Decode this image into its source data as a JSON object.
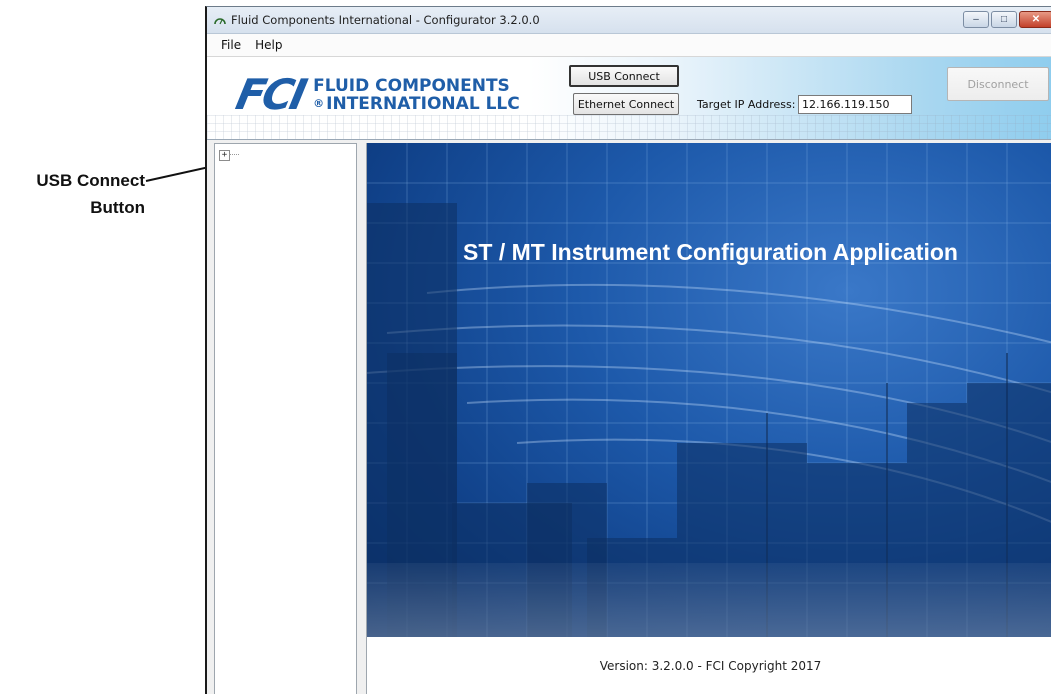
{
  "annotation": {
    "line1": "USB Connect",
    "line2": "Button"
  },
  "window": {
    "title": "Fluid Components International - Configurator 3.2.0.0",
    "controls": {
      "minimize": "‒",
      "maximize": "□",
      "close": "✕"
    }
  },
  "menu": {
    "items": [
      "File",
      "Help"
    ]
  },
  "header": {
    "logo_mark": "FCI",
    "logo_line1": "FLUID COMPONENTS",
    "logo_reg": "®",
    "logo_line2": "INTERNATIONAL LLC",
    "usb_connect": "USB Connect",
    "ethernet_connect": "Ethernet Connect",
    "ip_label": "Target IP Address:",
    "ip_value": "12.166.119.150",
    "disconnect": "Disconnect"
  },
  "tree": {
    "expand_glyph": "+"
  },
  "content": {
    "splash_title": "ST / MT Instrument Configuration Application",
    "version_text": "Version: 3.2.0.0 - FCI Copyright 2017"
  },
  "colors": {
    "brand_blue": "#1f5ea8",
    "splash_blue": "#1d59aa"
  }
}
